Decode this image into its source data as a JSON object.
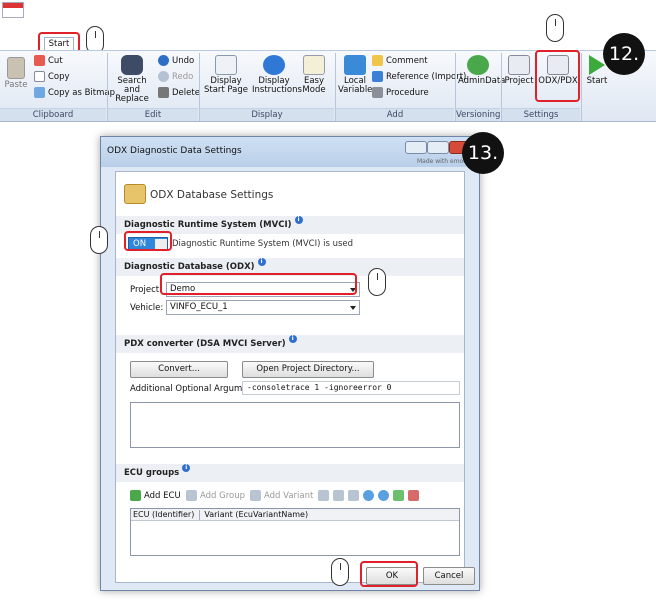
{
  "ribbon": {
    "start_tab": "Start",
    "paste": "Paste",
    "cut": "Cut",
    "copy": "Copy",
    "copy_bitmap": "Copy as Bitmap",
    "clipboard_group": "Clipboard",
    "search_replace": "Search and Replace",
    "undo": "Undo",
    "redo": "Redo",
    "delete": "Delete",
    "edit_group": "Edit",
    "display_start_page": "Display Start Page",
    "display_instructions": "Display Instructions",
    "easy_mode": "Easy Mode",
    "display_group": "Display",
    "local_variable": "Local Variable",
    "comment": "Comment",
    "reference_import": "Reference (Import)",
    "procedure": "Procedure",
    "add_group": "Add",
    "admin_data": "AdminData",
    "versioning_group": "Versioning",
    "project": "Project",
    "odx_pdx": "ODX/PDX",
    "settings_group": "Settings",
    "start_btn": "Start"
  },
  "steps": {
    "s12": "12.",
    "s13": "13."
  },
  "dialog": {
    "title": "ODX Diagnostic Data Settings",
    "made_with": "Made with emotive",
    "header": "ODX Database Settings",
    "mvci_section": "Diagnostic Runtime System (MVCI)",
    "toggle_label": "ON",
    "mvci_used": "Diagnostic Runtime System (MVCI) is used",
    "odx_section": "Diagnostic Database (ODX)",
    "project_label": "Project:",
    "project_value": "Demo",
    "vehicle_label": "Vehicle:",
    "vehicle_value": "VINFO_ECU_1",
    "pdx_section": "PDX converter (DSA MVCI Server)",
    "convert_btn": "Convert...",
    "open_dir_btn": "Open Project Directory...",
    "args_label": "Additional Optional Arguments:",
    "args_value": "-consoletrace 1 -ignoreerror 0",
    "ecu_section": "ECU groups",
    "add_ecu": "Add ECU",
    "add_group": "Add Group",
    "add_variant": "Add Variant",
    "col_ecu": "ECU (Identifier)",
    "col_variant": "Variant (EcuVariantName)",
    "ok": "OK",
    "cancel": "Cancel"
  },
  "colors": {
    "accent_red": "#e0212a",
    "step_badge": "#111111"
  }
}
